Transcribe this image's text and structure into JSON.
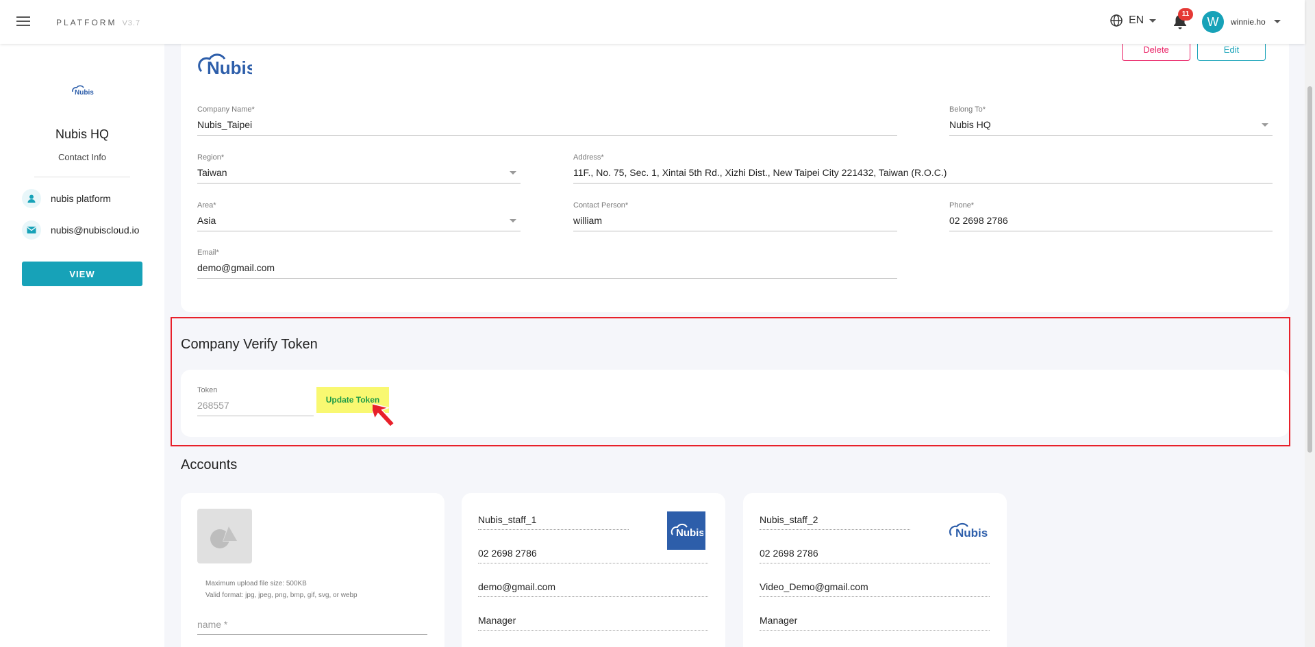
{
  "topbar": {
    "brand": "PLATFORM",
    "version": "V3.7",
    "language": "EN",
    "notification_count": "11",
    "avatar_initial": "W",
    "username": "winnie.ho"
  },
  "sidebar": {
    "logo_text": "Nubis",
    "company": "Nubis HQ",
    "subtitle": "Contact Info",
    "contact_name": "nubis platform",
    "contact_email": "nubis@nubiscloud.io",
    "view_label": "VIEW"
  },
  "company": {
    "logo_text": "Nubis",
    "delete_label": "Delete",
    "edit_label": "Edit",
    "fields": {
      "company_name": {
        "label": "Company Name*",
        "value": "Nubis_Taipei"
      },
      "belong_to": {
        "label": "Belong To*",
        "value": "Nubis HQ"
      },
      "region": {
        "label": "Region*",
        "value": "Taiwan"
      },
      "address": {
        "label": "Address*",
        "value": "11F., No. 75, Sec. 1, Xintai 5th Rd., Xizhi Dist., New Taipei City 221432, Taiwan (R.O.C.)"
      },
      "area": {
        "label": "Area*",
        "value": "Asia"
      },
      "contact_person": {
        "label": "Contact Person*",
        "value": "william"
      },
      "phone": {
        "label": "Phone*",
        "value": "02 2698 2786"
      },
      "email": {
        "label": "Email*",
        "value": "demo@gmail.com"
      }
    }
  },
  "token_section": {
    "title": "Company Verify Token",
    "token_label": "Token",
    "token_value": "268557",
    "update_label": "Update Token"
  },
  "accounts": {
    "title": "Accounts",
    "new_card": {
      "note_line1": "Maximum upload file size: 500KB",
      "note_line2": "Valid format: jpg, jpeg, png, bmp, gif, svg, or webp",
      "name_placeholder": "name *"
    },
    "items": [
      {
        "name": "Nubis_staff_1",
        "phone": "02 2698 2786",
        "email": "demo@gmail.com",
        "role": "Manager",
        "logo_text": "Nubis"
      },
      {
        "name": "Nubis_staff_2",
        "phone": "02 2698 2786",
        "email": "Video_Demo@gmail.com",
        "role": "Manager",
        "logo_text": "Nubis"
      }
    ]
  },
  "colors": {
    "accent": "#17a2b8",
    "delete": "#e91e63",
    "highlight": "#e8202a",
    "token_button_bg": "#f9f871",
    "brand_blue": "#2d5eaa"
  }
}
